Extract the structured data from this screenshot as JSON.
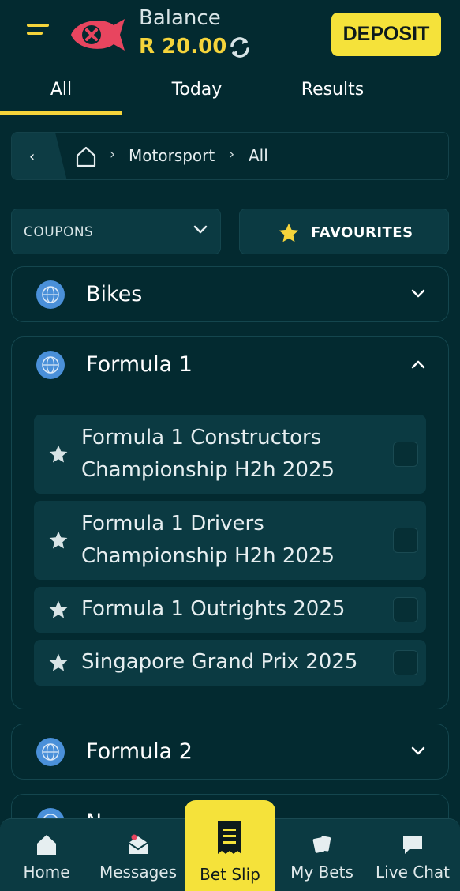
{
  "header": {
    "balance_label": "Balance",
    "balance_value": "R 20.00",
    "deposit_label": "DEPOSIT",
    "accent_color": "#f5d43b"
  },
  "tabs": [
    {
      "label": "All",
      "active": true
    },
    {
      "label": "Today",
      "active": false
    },
    {
      "label": "Results",
      "active": false
    }
  ],
  "breadcrumb": {
    "items": [
      "Motorsport",
      "All"
    ]
  },
  "filters": {
    "coupons_label": "COUPONS",
    "favourites_label": "FAVOURITES"
  },
  "sections": [
    {
      "title": "Bikes",
      "expanded": false
    },
    {
      "title": "Formula 1",
      "expanded": true,
      "leagues": [
        "Formula 1 Constructors Championship H2h 2025",
        "Formula 1 Drivers Championship H2h 2025",
        "Formula 1 Outrights 2025",
        "Singapore Grand Prix 2025"
      ]
    },
    {
      "title": "Formula 2",
      "expanded": false
    },
    {
      "title": "N",
      "expanded": false
    }
  ],
  "bottom_nav": {
    "home": "Home",
    "messages": "Messages",
    "bet_slip": "Bet Slip",
    "my_bets": "My Bets",
    "live_chat": "Live Chat"
  }
}
